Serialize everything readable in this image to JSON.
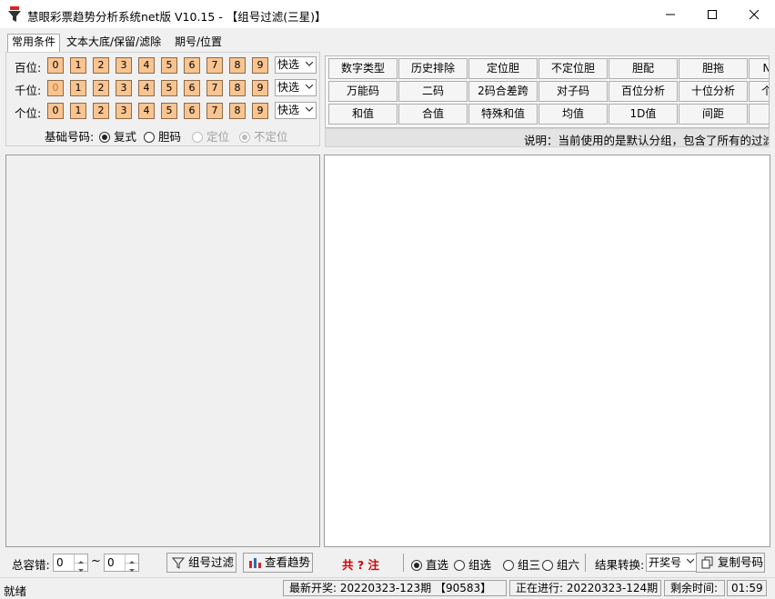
{
  "window": {
    "title": "慧眼彩票趋势分析系统net版 V10.15 - 【组号过滤(三星)】",
    "minimize": "—",
    "maximize": "☐",
    "close": "✕"
  },
  "tabs": [
    "常用条件",
    "文本大底/保留/滤除",
    "期号/位置"
  ],
  "positions": {
    "rows": [
      {
        "label": "百位:",
        "digits": [
          "0",
          "1",
          "2",
          "3",
          "4",
          "5",
          "6",
          "7",
          "8",
          "9"
        ],
        "quick": "快选"
      },
      {
        "label": "千位:",
        "digits": [
          "0",
          "1",
          "2",
          "3",
          "4",
          "5",
          "6",
          "7",
          "8",
          "9"
        ],
        "quick": "快选"
      },
      {
        "label": "个位:",
        "digits": [
          "0",
          "1",
          "2",
          "3",
          "4",
          "5",
          "6",
          "7",
          "8",
          "9"
        ],
        "quick": "快选"
      }
    ]
  },
  "base_code": {
    "label": "基础号码:",
    "options": [
      {
        "label": "复式",
        "selected": true,
        "disabled": false
      },
      {
        "label": "胆码",
        "selected": false,
        "disabled": false
      },
      {
        "label": "定位",
        "selected": false,
        "disabled": true
      },
      {
        "label": "不定位",
        "selected": true,
        "disabled": true
      }
    ]
  },
  "grid": {
    "rows": [
      [
        "数字类型",
        "历史排除",
        "定位胆",
        "不定位胆",
        "胆配",
        "胆拖",
        "N"
      ],
      [
        "万能码",
        "二码",
        "2码合差跨",
        "对子码",
        "百位分析",
        "十位分析",
        "个"
      ],
      [
        "和值",
        "合值",
        "特殊和值",
        "均值",
        "1D值",
        "间距",
        ""
      ]
    ],
    "description": "说明：当前使用的是默认分组，包含了所有的过滤条"
  },
  "toolbar": {
    "tolerance_label": "总容错:",
    "from_value": "0",
    "tilde": "~",
    "to_value": "0",
    "filter_button": "组号过滤",
    "trend_button": "查看趋势",
    "total_label": "共 ? 注",
    "select_options": [
      {
        "label": "直选",
        "selected": true
      },
      {
        "label": "组选",
        "selected": false
      },
      {
        "label": "组三",
        "selected": false
      },
      {
        "label": "组六",
        "selected": false
      }
    ],
    "convert_label": "结果转换:",
    "convert_value": "开奖号",
    "copy_button": "复制号码"
  },
  "status": {
    "ready": "就绪",
    "latest": "最新开奖: 20220323-123期 【90583】",
    "current": "正在进行: 20220323-124期",
    "remaining_label": "剩余时间:",
    "remaining_value": "01:59"
  },
  "colors": {
    "digit_button": "#f9c490",
    "total_label": "#d40000"
  }
}
